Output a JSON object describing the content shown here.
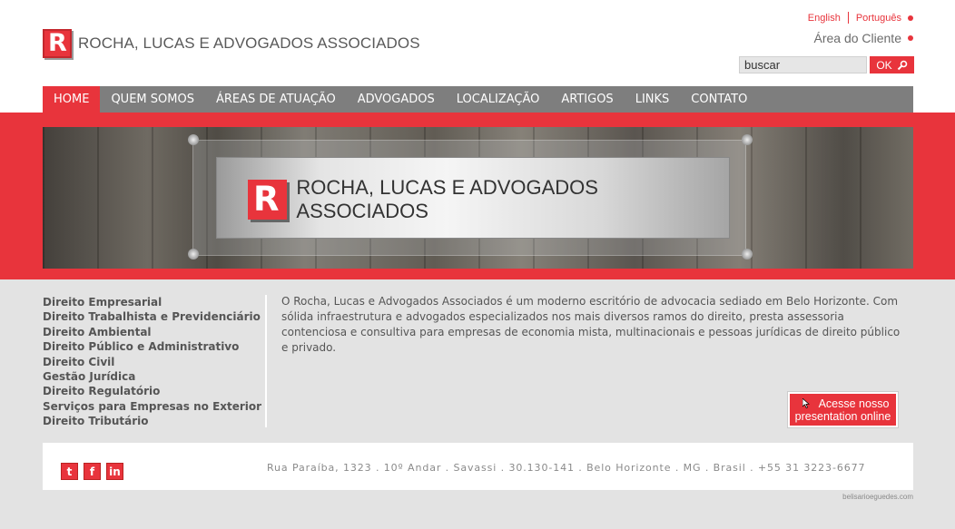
{
  "brand": {
    "logo_letter": "R",
    "name": "ROCHA, LUCAS E ADVOGADOS ASSOCIADOS"
  },
  "languages": [
    "English",
    "Português"
  ],
  "client_area": "Área do Cliente",
  "search": {
    "value": "buscar",
    "button": "OK"
  },
  "nav": [
    "HOME",
    "QUEM SOMOS",
    "ÁREAS DE ATUAÇÃO",
    "ADVOGADOS",
    "LOCALIZAÇÃO",
    "ARTIGOS",
    "LINKS",
    "CONTATO"
  ],
  "active_nav": "HOME",
  "banner": {
    "letter": "R",
    "name": "ROCHA, LUCAS E ADVOGADOS ASSOCIADOS"
  },
  "areas": [
    "Direito Empresarial",
    "Direito Trabalhista e Previdenciário",
    "Direito Ambiental",
    "Direito Público e Administrativo",
    "Direito Civil",
    "Gestão Jurídica",
    "Direito Regulatório",
    "Serviços para Empresas no Exterior",
    "Direito Tributário"
  ],
  "about": "O Rocha, Lucas e Advogados Associados é um moderno escritório de advocacia sediado em Belo Horizonte. Com sólida infraestrutura e advogados especializados nos mais diversos ramos do direito, presta assessoria contenciosa e consultiva para empresas de economia mista, multinacionais e pessoas jurídicas de direito público e privado.",
  "cta": {
    "line1": "Acesse nosso",
    "line2": "presentation online"
  },
  "social": [
    {
      "icon": "twitter-icon",
      "glyph": "t"
    },
    {
      "icon": "facebook-icon",
      "glyph": "f"
    },
    {
      "icon": "linkedin-icon",
      "glyph": "in"
    }
  ],
  "address": "Rua Paraíba, 1323 . 10º Andar . Savassi . 30.130-141 . Belo Horizonte . MG . Brasil . +55 31 3223-6677",
  "credit": "belisarioeguedes.com",
  "colors": {
    "accent": "#e8343c",
    "nav_bg": "#7e7e7e",
    "page_bg": "#e3e3e3"
  }
}
